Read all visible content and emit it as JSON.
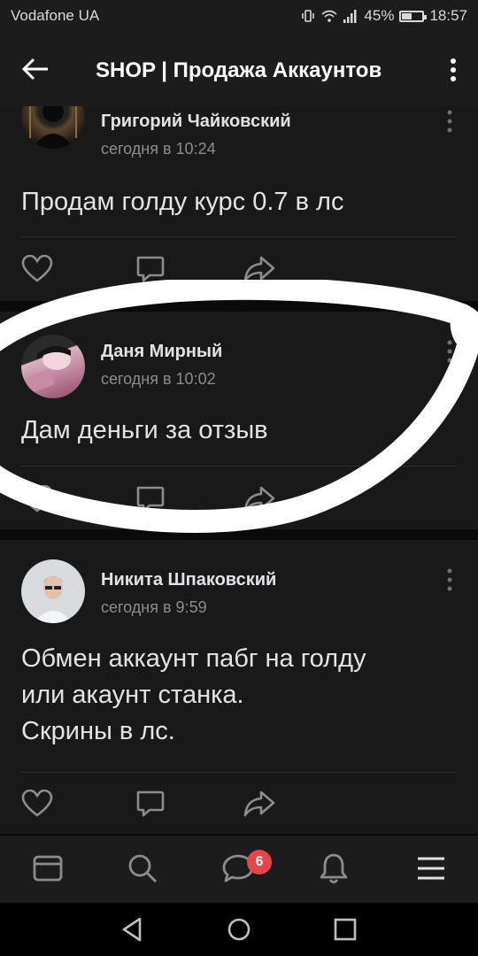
{
  "status_bar": {
    "carrier": "Vodafone UA",
    "battery": "45%",
    "battery_level": 0.45,
    "time": "18:57"
  },
  "header": {
    "title": "SHOP | Продажа Аккаунтов"
  },
  "posts": [
    {
      "author": "Григорий Чайковский",
      "time": "сегодня в 10:24",
      "text": "Продам голду курс 0.7 в лс"
    },
    {
      "author": "Даня Мирный",
      "time": "сегодня в 10:02",
      "text": "Дам деньги за отзыв"
    },
    {
      "author": "Никита Шпаковский",
      "time": "сегодня в 9:59",
      "text_lines": [
        "Обмен аккаунт пабг на голду",
        "или акаунт станка.",
        "Скрины в лс."
      ]
    }
  ],
  "bottom_nav": {
    "items": [
      "news-icon",
      "search-icon",
      "messages-icon",
      "bell-icon",
      "menu-icon"
    ],
    "messages_badge": "6"
  },
  "colors": {
    "background": "#0a0a0a",
    "card": "#191919",
    "header": "#1c1c1c",
    "text": "#e1e3e6",
    "secondary": "#8a8c8f",
    "badge": "#e64646"
  }
}
